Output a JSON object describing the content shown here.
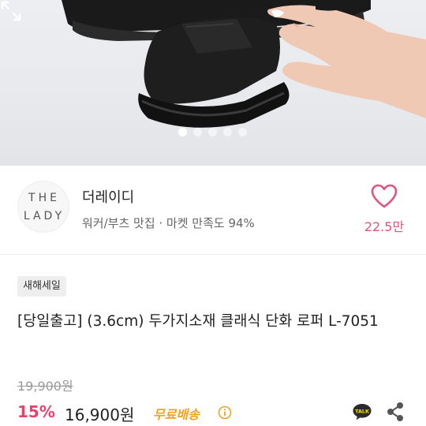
{
  "gallery": {
    "image_alt": "black loafer shoe held by hand",
    "dots": 5,
    "active_index": 0
  },
  "store": {
    "logo_line1": "THE",
    "logo_line2": "LADY",
    "name": "더레이디",
    "description": "워커/부츠 맛집 · 마켓 만족도 94%",
    "likes": "22.5만"
  },
  "product": {
    "badge": "새해세일",
    "title": "[당일출고] (3.6cm) 두가지소재 클래식 단화 로퍼 L-7051",
    "original_price": "19,900원",
    "discount": "15%",
    "price": "16,900원",
    "shipping": "무료배송"
  },
  "icons": {
    "expand": "expand-icon",
    "heart": "heart-icon",
    "info": "info-icon",
    "talk": "kakao-talk-icon",
    "share": "share-icon"
  },
  "colors": {
    "accent_pink": "#e8416c",
    "like_pink": "#e0557a",
    "shipping_orange": "#f2a21b"
  }
}
